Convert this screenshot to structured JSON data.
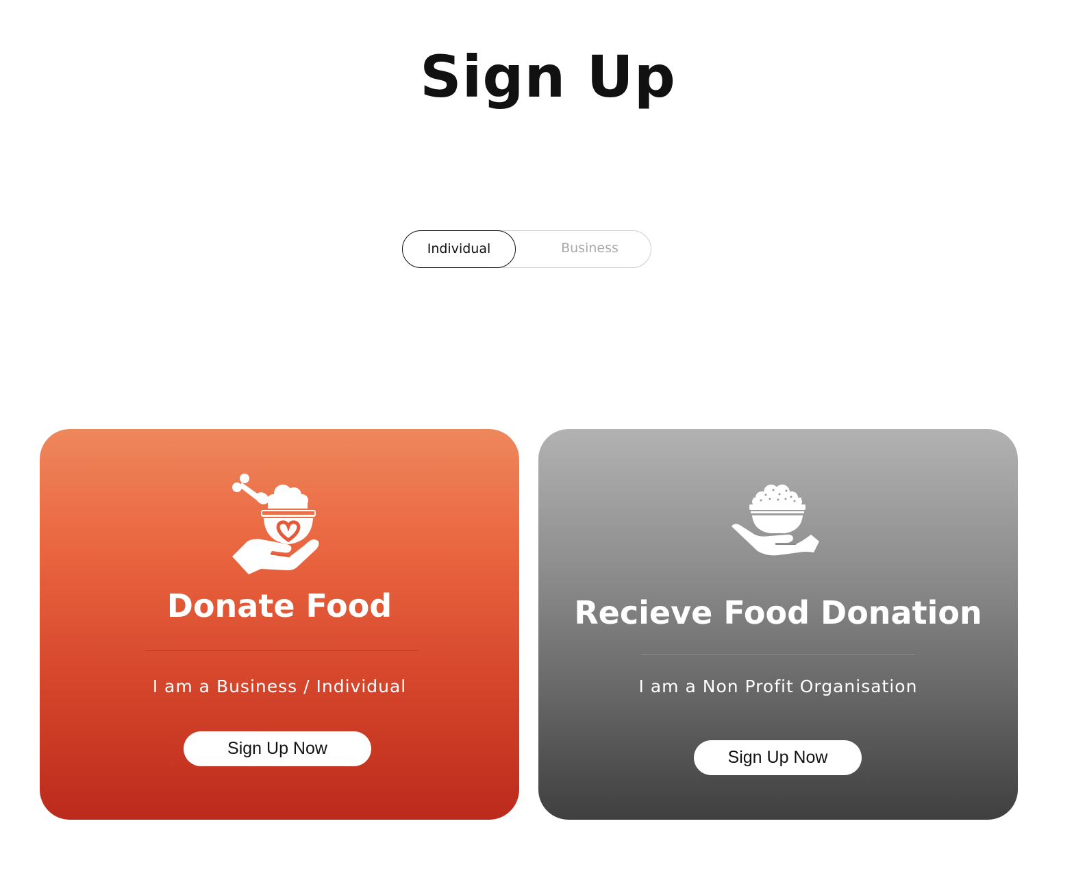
{
  "page": {
    "title": "Sign Up"
  },
  "account_toggle": {
    "options": [
      {
        "label": "Individual",
        "selected": true
      },
      {
        "label": "Business",
        "selected": false
      }
    ]
  },
  "cards": [
    {
      "heading": "Donate Food",
      "subtitle": "I am a Business / Individual",
      "button_label": "Sign Up Now",
      "icon": "hand-holding-food-bowl-with-heart-icon",
      "gradient_top": "#ee875c",
      "gradient_bottom": "#bb2a1b"
    },
    {
      "heading": "Recieve Food Donation",
      "subtitle": "I am a Non Profit Organisation",
      "button_label": "Sign Up Now",
      "icon": "hand-holding-rice-bowl-icon",
      "gradient_top": "#b2b2b2",
      "gradient_bottom": "#3f3f3f"
    }
  ],
  "colors": {
    "background": "#ffffff",
    "title_text": "#111111",
    "toggle_inactive_text": "#a8a8a8",
    "card_text": "#ffffff",
    "button_bg": "#ffffff"
  }
}
